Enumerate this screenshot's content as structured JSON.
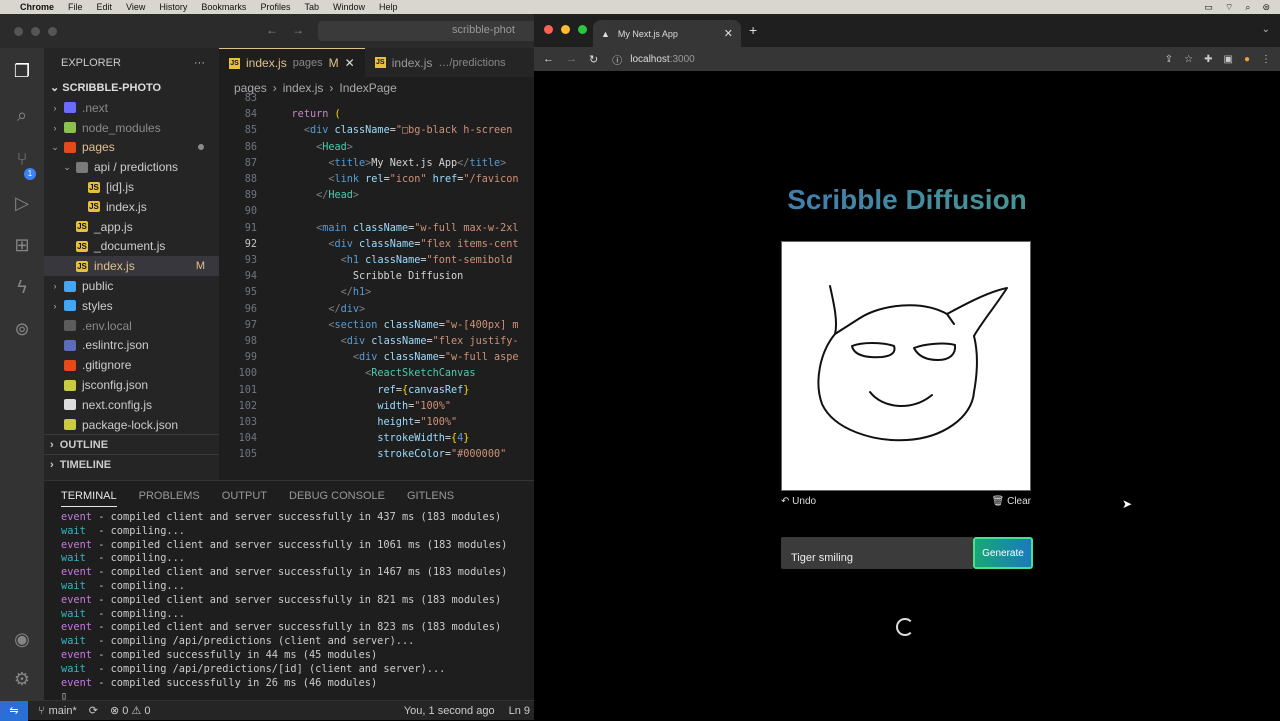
{
  "menubar": {
    "app": "Chrome",
    "items": [
      "File",
      "Edit",
      "View",
      "History",
      "Bookmarks",
      "Profiles",
      "Tab",
      "Window",
      "Help"
    ]
  },
  "vscode": {
    "search": "scribble-phot",
    "explorer_title": "EXPLORER",
    "project": "SCRIBBLE-PHOTO",
    "tree": [
      {
        "label": ".next",
        "indent": 1,
        "chev": "›",
        "icon": "#6b6bff",
        "dim": true
      },
      {
        "label": "node_modules",
        "indent": 1,
        "chev": "›",
        "icon": "#8bc34a",
        "dim": true
      },
      {
        "label": "pages",
        "indent": 1,
        "chev": "⌄",
        "icon": "#e64a19",
        "yel": true,
        "dot": true
      },
      {
        "label": "api / predictions",
        "indent": 2,
        "chev": "⌄",
        "icon": "#7a7a7a"
      },
      {
        "label": "[id].js",
        "indent": 3,
        "chev": "",
        "icon": "#e8c13b",
        "js": true
      },
      {
        "label": "index.js",
        "indent": 3,
        "chev": "",
        "icon": "#e8c13b",
        "js": true
      },
      {
        "label": "_app.js",
        "indent": 2,
        "chev": "",
        "icon": "#e8c13b",
        "js": true
      },
      {
        "label": "_document.js",
        "indent": 2,
        "chev": "",
        "icon": "#e8c13b",
        "js": true
      },
      {
        "label": "index.js",
        "indent": 2,
        "chev": "",
        "icon": "#e8c13b",
        "js": true,
        "sel": true,
        "yel": true,
        "status": "M"
      },
      {
        "label": "public",
        "indent": 1,
        "chev": "›",
        "icon": "#42a5f5"
      },
      {
        "label": "styles",
        "indent": 1,
        "chev": "›",
        "icon": "#42a5f5"
      },
      {
        "label": ".env.local",
        "indent": 1,
        "chev": "",
        "icon": "#5c5c5c",
        "dim": true
      },
      {
        "label": ".eslintrc.json",
        "indent": 1,
        "chev": "",
        "icon": "#5c6bc0"
      },
      {
        "label": ".gitignore",
        "indent": 1,
        "chev": "",
        "icon": "#e64a19"
      },
      {
        "label": "jsconfig.json",
        "indent": 1,
        "chev": "",
        "icon": "#cbcb41"
      },
      {
        "label": "next.config.js",
        "indent": 1,
        "chev": "",
        "icon": "#dddddd"
      },
      {
        "label": "package-lock.json",
        "indent": 1,
        "chev": "",
        "icon": "#cbcb41"
      }
    ],
    "outline": "OUTLINE",
    "timeline": "TIMELINE",
    "tabs": [
      {
        "name": "index.js",
        "sub": "pages",
        "flag": "M",
        "close": "✕",
        "active": true
      },
      {
        "name": "index.js",
        "sub": "…/predictions",
        "active": false
      }
    ],
    "breadcrumb": [
      "pages",
      "›",
      "index.js",
      "›",
      "IndexPage"
    ],
    "code": [
      {
        "n": "83",
        "html": ""
      },
      {
        "n": "84",
        "html": "    <span class='kw'>return</span> <span class='br'>(</span>"
      },
      {
        "n": "85",
        "html": "      <span class='gr'>&lt;</span><span class='tg'>div</span> <span class='at'>className</span>=<span class='sv'>\"□bg-black h-screen</span>"
      },
      {
        "n": "86",
        "html": "        <span class='gr'>&lt;</span><span class='cmp'>Head</span><span class='gr'>&gt;</span>"
      },
      {
        "n": "87",
        "html": "          <span class='gr'>&lt;</span><span class='tg'>title</span><span class='gr'>&gt;</span>My Next.js App<span class='gr'>&lt;/</span><span class='tg'>title</span><span class='gr'>&gt;</span>"
      },
      {
        "n": "88",
        "html": "          <span class='gr'>&lt;</span><span class='tg'>link</span> <span class='at'>rel</span>=<span class='sv'>\"icon\"</span> <span class='at'>href</span>=<span class='sv'>\"/favicon</span>"
      },
      {
        "n": "89",
        "html": "        <span class='gr'>&lt;/</span><span class='cmp'>Head</span><span class='gr'>&gt;</span>"
      },
      {
        "n": "90",
        "html": ""
      },
      {
        "n": "91",
        "html": "        <span class='gr'>&lt;</span><span class='tg'>main</span> <span class='at'>className</span>=<span class='sv'>\"w-full max-w-2xl</span>"
      },
      {
        "n": "92",
        "html": "          <span class='gr'>&lt;</span><span class='tg'>div</span> <span class='at'>className</span>=<span class='sv'>\"flex items-cent</span>",
        "cur": true
      },
      {
        "n": "93",
        "html": "            <span class='gr'>&lt;</span><span class='tg'>h1</span> <span class='at'>className</span>=<span class='sv'>\"font-semibold</span>"
      },
      {
        "n": "94",
        "html": "              Scribble Diffusion"
      },
      {
        "n": "95",
        "html": "            <span class='gr'>&lt;/</span><span class='tg'>h1</span><span class='gr'>&gt;</span>"
      },
      {
        "n": "96",
        "html": "          <span class='gr'>&lt;/</span><span class='tg'>div</span><span class='gr'>&gt;</span>"
      },
      {
        "n": "97",
        "html": "          <span class='gr'>&lt;</span><span class='tg'>section</span> <span class='at'>className</span>=<span class='sv'>\"w-[400px] m</span>"
      },
      {
        "n": "98",
        "html": "            <span class='gr'>&lt;</span><span class='tg'>div</span> <span class='at'>className</span>=<span class='sv'>\"flex justify-</span>"
      },
      {
        "n": "99",
        "html": "              <span class='gr'>&lt;</span><span class='tg'>div</span> <span class='at'>className</span>=<span class='sv'>\"w-full aspe</span>"
      },
      {
        "n": "100",
        "html": "                <span class='gr'>&lt;</span><span class='cmp'>ReactSketchCanvas</span>"
      },
      {
        "n": "101",
        "html": "                  <span class='at'>ref</span>=<span class='br'>{</span><span class='at'>canvasRef</span><span class='br'>}</span>"
      },
      {
        "n": "102",
        "html": "                  <span class='at'>width</span>=<span class='sv'>\"100%\"</span>"
      },
      {
        "n": "103",
        "html": "                  <span class='at'>height</span>=<span class='sv'>\"100%\"</span>"
      },
      {
        "n": "104",
        "html": "                  <span class='at'>strokeWidth</span>=<span class='br'>{</span><span class='tg'>4</span><span class='br'>}</span>"
      },
      {
        "n": "105",
        "html": "                  <span class='at'>strokeColor</span>=<span class='sv'>\"#000000\"</span>"
      }
    ],
    "term_tabs": [
      "TERMINAL",
      "PROBLEMS",
      "OUTPUT",
      "DEBUG CONSOLE",
      "GITLENS"
    ],
    "terminal": [
      {
        "k": "event",
        "t": " - compiled client and server successfully in 437 ms (183 modules)"
      },
      {
        "k": "wait",
        "t": "  - compiling..."
      },
      {
        "k": "event",
        "t": " - compiled client and server successfully in 1061 ms (183 modules)"
      },
      {
        "k": "wait",
        "t": "  - compiling..."
      },
      {
        "k": "event",
        "t": " - compiled client and server successfully in 1467 ms (183 modules)"
      },
      {
        "k": "wait",
        "t": "  - compiling..."
      },
      {
        "k": "event",
        "t": " - compiled client and server successfully in 821 ms (183 modules)"
      },
      {
        "k": "wait",
        "t": "  - compiling..."
      },
      {
        "k": "event",
        "t": " - compiled client and server successfully in 823 ms (183 modules)"
      },
      {
        "k": "wait",
        "t": "  - compiling /api/predictions (client and server)..."
      },
      {
        "k": "event",
        "t": " - compiled successfully in 44 ms (45 modules)"
      },
      {
        "k": "wait",
        "t": "  - compiling /api/predictions/[id] (client and server)..."
      },
      {
        "k": "event",
        "t": " - compiled successfully in 26 ms (46 modules)"
      },
      {
        "k": "",
        "t": "▯"
      }
    ],
    "status": {
      "branch": "main*",
      "problems": "⊗ 0  ⚠ 0",
      "blame": "You, 1 second ago",
      "ln": "Ln 9"
    }
  },
  "chrome": {
    "tab_title": "My Next.js App",
    "tab_close": "✕",
    "new_tab": "+",
    "url_host": "localhost",
    "url_port": ":3000",
    "page": {
      "title": "Scribble Diffusion",
      "undo": "↶ Undo",
      "clear": "🗑 Clear",
      "prompt_value": "Tiger smiling",
      "generate": "Generate"
    }
  },
  "colors": {
    "accent_start": "#3b66c7",
    "accent_end": "#4cae7a",
    "button_start": "#18a874",
    "button_end": "#1b79bf"
  }
}
